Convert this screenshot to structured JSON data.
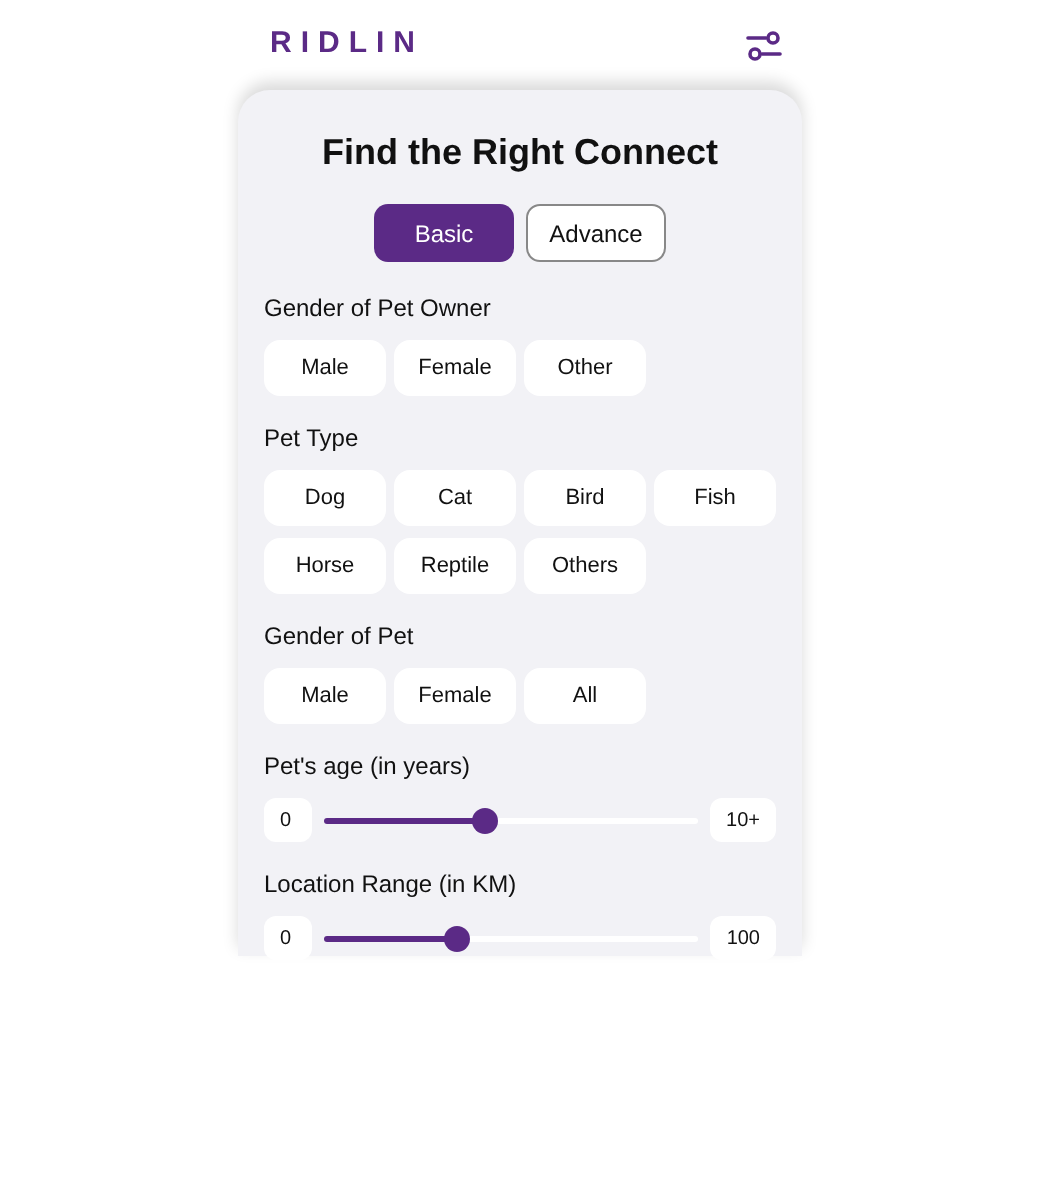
{
  "brand": "RIDLIN",
  "title": "Find the Right Connect",
  "tabs": [
    {
      "label": "Basic",
      "selected": true
    },
    {
      "label": "Advance",
      "selected": false
    }
  ],
  "sections": [
    {
      "kind": "chips",
      "label": "Gender of Pet Owner",
      "options": [
        "Male",
        "Female",
        "Other"
      ]
    },
    {
      "kind": "chips",
      "label": "Pet Type",
      "options": [
        "Dog",
        "Cat",
        "Bird",
        "Fish",
        "Horse",
        "Reptile",
        "Others"
      ]
    },
    {
      "kind": "chips",
      "label": "Gender of Pet",
      "options": [
        "Male",
        "Female",
        "All"
      ]
    },
    {
      "kind": "slider",
      "label": "Pet's age (in years)",
      "min": "0",
      "max": "10+",
      "level": 0.43
    },
    {
      "kind": "slider",
      "label": "Location Range (in KM)",
      "min": "0",
      "max": "100",
      "level": 0.35
    }
  ]
}
